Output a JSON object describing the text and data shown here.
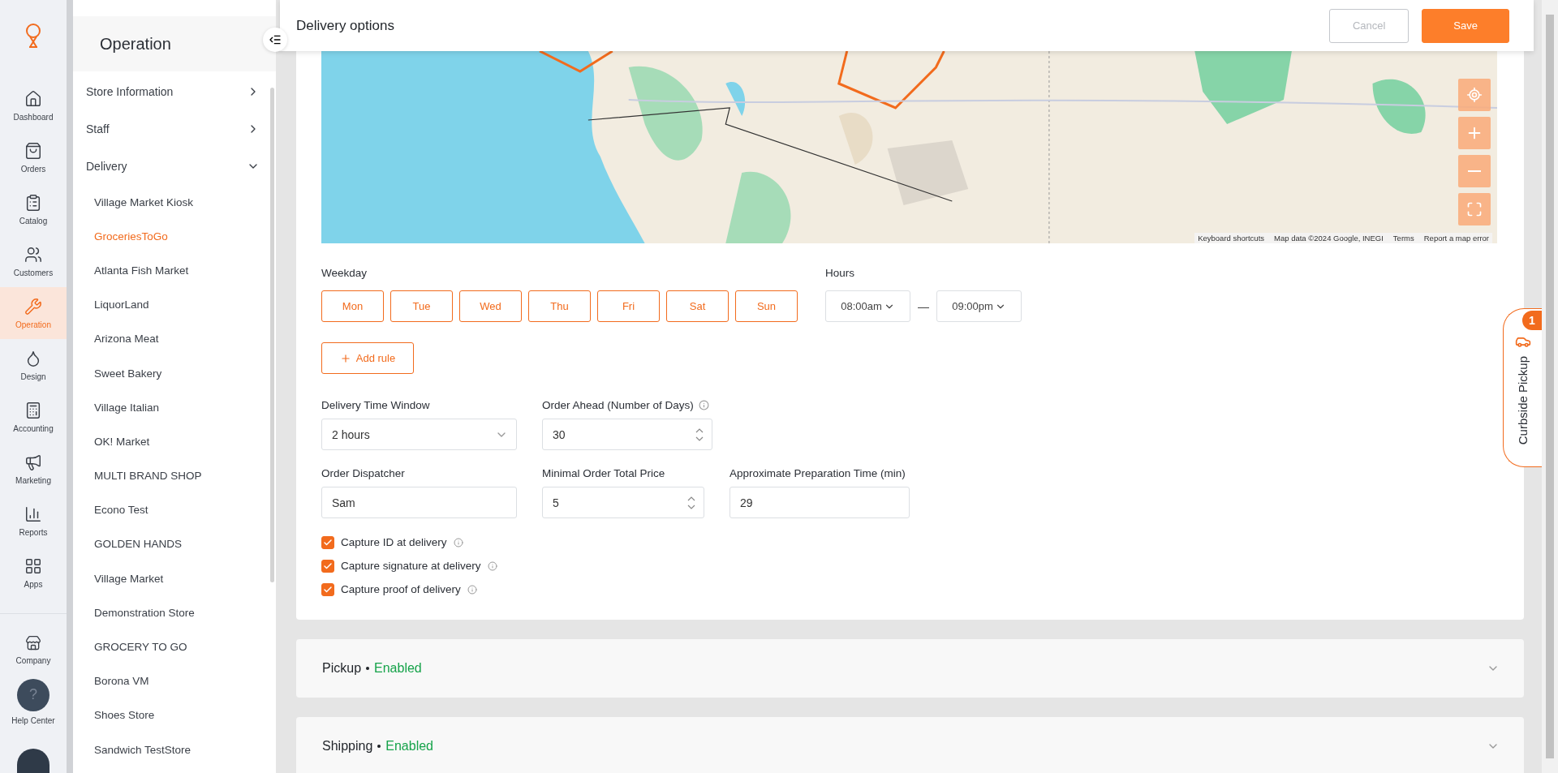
{
  "rail": {
    "items": [
      {
        "label": "Dashboard",
        "selected": false
      },
      {
        "label": "Orders",
        "selected": false
      },
      {
        "label": "Catalog",
        "selected": false
      },
      {
        "label": "Customers",
        "selected": false
      },
      {
        "label": "Operation",
        "selected": true
      },
      {
        "label": "Design",
        "selected": false
      },
      {
        "label": "Accounting",
        "selected": false
      },
      {
        "label": "Marketing",
        "selected": false
      },
      {
        "label": "Reports",
        "selected": false
      },
      {
        "label": "Apps",
        "selected": false
      }
    ],
    "bottom": [
      {
        "label": "Company",
        "kind": "store"
      },
      {
        "label": "Help Center",
        "kind": "help",
        "icon_text": "?"
      }
    ]
  },
  "sidebar": {
    "title": "Operation",
    "items": [
      {
        "label": "Store Information",
        "expanded": false
      },
      {
        "label": "Staff",
        "expanded": false
      },
      {
        "label": "Delivery",
        "expanded": true,
        "children": [
          {
            "label": "Village Market Kiosk",
            "selected": false
          },
          {
            "label": "GroceriesToGo",
            "selected": true
          },
          {
            "label": "Atlanta Fish Market",
            "selected": false
          },
          {
            "label": "LiquorLand",
            "selected": false
          },
          {
            "label": "Arizona Meat",
            "selected": false
          },
          {
            "label": "Sweet Bakery",
            "selected": false
          },
          {
            "label": "Village Italian",
            "selected": false
          },
          {
            "label": "OK! Market",
            "selected": false
          },
          {
            "label": "MULTI BRAND SHOP",
            "selected": false
          },
          {
            "label": "Econo Test",
            "selected": false
          },
          {
            "label": "GOLDEN HANDS",
            "selected": false
          },
          {
            "label": "Village Market",
            "selected": false
          },
          {
            "label": "Demonstration Store",
            "selected": false
          },
          {
            "label": "GROCERY TO GO",
            "selected": false
          },
          {
            "label": "Borona VM",
            "selected": false
          },
          {
            "label": "Shoes Store",
            "selected": false
          },
          {
            "label": "Sandwich TestStore",
            "selected": false
          }
        ]
      }
    ]
  },
  "header": {
    "title": "Delivery options",
    "buttons": [
      {
        "label": "Cancel",
        "kind": "secondary",
        "disabled": true
      },
      {
        "label": "Save",
        "kind": "primary",
        "disabled": false
      }
    ]
  },
  "map": {
    "kind": "picture",
    "attribution": [
      "Keyboard shortcuts",
      "Map data ©2024 Google, INEGI",
      "Terms",
      "Report a map error"
    ]
  },
  "weekday": {
    "label": "Weekday",
    "days": [
      {
        "label": "Mon",
        "selected": true
      },
      {
        "label": "Tue",
        "selected": true
      },
      {
        "label": "Wed",
        "selected": true
      },
      {
        "label": "Thu",
        "selected": true
      },
      {
        "label": "Fri",
        "selected": true
      },
      {
        "label": "Sat",
        "selected": true
      },
      {
        "label": "Sun",
        "selected": true
      }
    ]
  },
  "hours": {
    "label": "Hours",
    "from": "08:00am",
    "separator": "—",
    "to": "09:00pm"
  },
  "add_rule": "Add rule",
  "fields": [
    [
      {
        "label": "Delivery Time Window",
        "kind": "select",
        "value": "2 hours",
        "info": false
      },
      {
        "label": "Order Ahead (Number of Days)",
        "kind": "number",
        "value": "30",
        "info": true
      }
    ],
    [
      {
        "label": "Order Dispatcher",
        "kind": "text",
        "value": "Sam",
        "info": false
      },
      {
        "label": "Minimal Order Total Price",
        "kind": "number",
        "value": "5",
        "info": false
      },
      {
        "label": "Approximate Preparation Time (min)",
        "kind": "text",
        "value": "29",
        "info": false
      }
    ]
  ],
  "checkboxes": [
    {
      "label": "Capture ID at delivery",
      "checked": true
    },
    {
      "label": "Capture signature at delivery",
      "checked": true
    },
    {
      "label": "Capture proof of delivery",
      "checked": true
    }
  ],
  "sections": [
    {
      "title": "Pickup",
      "status": "Enabled",
      "enabled": true
    },
    {
      "title": "Shipping",
      "status": "Enabled",
      "enabled": true
    }
  ],
  "curbside": {
    "label": "Curbside Pickup",
    "badge": "1"
  }
}
